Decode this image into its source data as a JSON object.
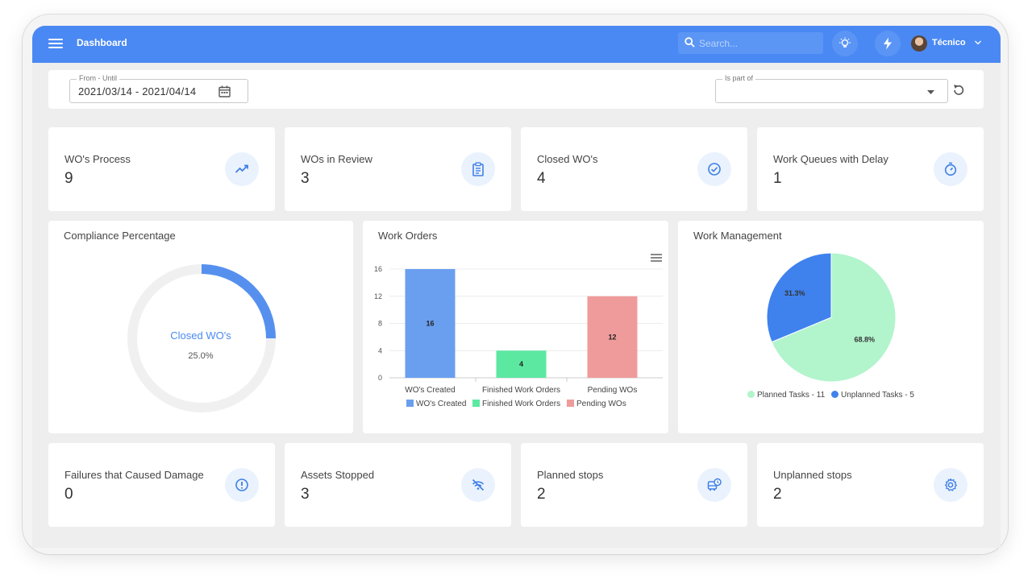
{
  "header": {
    "title": "Dashboard",
    "search_placeholder": "Search...",
    "user_name": "Técnico"
  },
  "filters": {
    "date_label": "From - Until",
    "date_value": "2021/03/14 - 2021/04/14",
    "part_of_label": "Is part of",
    "part_of_value": ""
  },
  "stats_top": [
    {
      "label": "WO's Process",
      "value": "9",
      "icon": "trending-up-icon"
    },
    {
      "label": "WOs in Review",
      "value": "3",
      "icon": "clipboard-icon"
    },
    {
      "label": "Closed WO's",
      "value": "4",
      "icon": "check-circle-icon"
    },
    {
      "label": "Work Queues with Delay",
      "value": "1",
      "icon": "timer-icon"
    }
  ],
  "stats_bottom": [
    {
      "label": "Failures that Caused Damage",
      "value": "0",
      "icon": "alert-circle-icon"
    },
    {
      "label": "Assets Stopped",
      "value": "3",
      "icon": "no-signal-icon"
    },
    {
      "label": "Planned stops",
      "value": "2",
      "icon": "bus-clock-icon"
    },
    {
      "label": "Unplanned stops",
      "value": "2",
      "icon": "gear-icon"
    }
  ],
  "compliance": {
    "title": "Compliance Percentage",
    "center_label": "Closed WO's",
    "center_value": "25.0%",
    "fraction": 0.25
  },
  "work_orders": {
    "title": "Work Orders",
    "legend": [
      "WO's Created",
      "Finished Work Orders",
      "Pending WOs"
    ]
  },
  "work_management": {
    "title": "Work Management",
    "legend": [
      "Planned Tasks - 11",
      "Unplanned Tasks - 5"
    ]
  },
  "chart_data": [
    {
      "type": "bar",
      "title": "Work Orders",
      "categories": [
        "WO's Created",
        "Finished Work Orders",
        "Pending WOs"
      ],
      "values": [
        16,
        4,
        12
      ],
      "colors": [
        "#6a9ff0",
        "#5de8a2",
        "#ef9b9b"
      ],
      "yticks": [
        0,
        4,
        8,
        12,
        16
      ],
      "ylim": [
        0,
        16
      ],
      "xlabel": "",
      "ylabel": "",
      "grid": true,
      "legend_position": "bottom"
    },
    {
      "type": "pie",
      "title": "Work Management",
      "labels": [
        "Planned Tasks - 11",
        "Unplanned Tasks - 5"
      ],
      "values": [
        11,
        5
      ],
      "value_labels": [
        "68.8%",
        "31.3%"
      ],
      "colors": [
        "#b2f4cc",
        "#3f82ee"
      ],
      "legend_position": "bottom"
    }
  ],
  "colors": {
    "primary": "#4a89f3",
    "background": "#eeeeee",
    "card": "#ffffff",
    "icon_bg": "#eaf2fd"
  }
}
